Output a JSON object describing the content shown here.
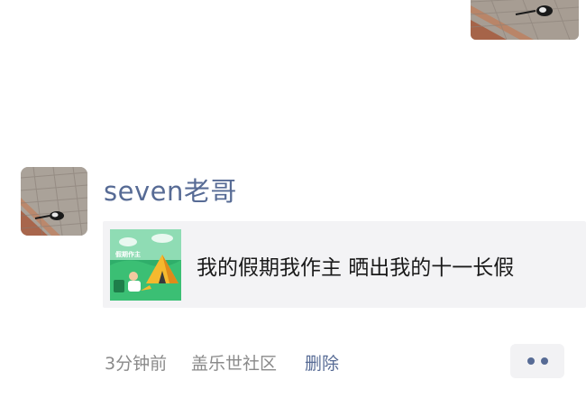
{
  "previous_post": {
    "photo_icon": "street-photo"
  },
  "post": {
    "username": "seven老哥",
    "avatar_icon": "street-photo-avatar",
    "link_card": {
      "title": "我的假期我作主 晒出我的十一长假",
      "thumbnail_icon": "camping-illustration",
      "thumbnail_text": "假期作主"
    },
    "footer": {
      "time": "3分钟前",
      "source": "盖乐世社区",
      "delete_label": "删除",
      "more_icon": "more-dots-icon"
    }
  },
  "colors": {
    "link_blue": "#576b95",
    "meta_gray": "#8a8a8a",
    "card_bg": "#f3f3f5"
  }
}
